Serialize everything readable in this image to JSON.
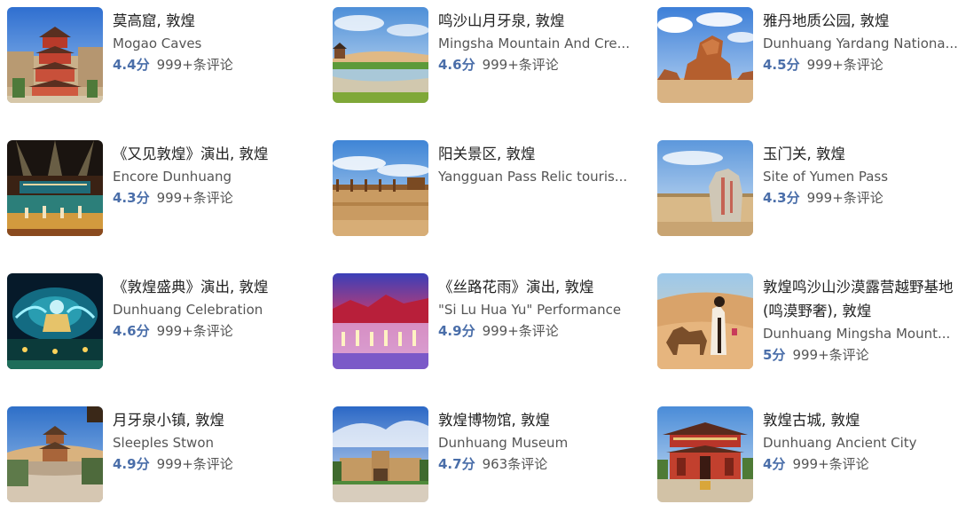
{
  "items": [
    {
      "title": "莫高窟, 敦煌",
      "en": "Mogao Caves",
      "rating": "4.4分",
      "reviews": "999+条评论",
      "image": "mogao-caves-pagoda-photo"
    },
    {
      "title": "鸣沙山月牙泉, 敦煌",
      "en": "Mingsha Mountain And Cre...",
      "rating": "4.6分",
      "reviews": "999+条评论",
      "image": "crescent-lake-photo"
    },
    {
      "title": "雅丹地质公园, 敦煌",
      "en": "Dunhuang Yardang Nationa...",
      "rating": "4.5分",
      "reviews": "999+条评论",
      "image": "yardang-rock-photo"
    },
    {
      "title": "《又见敦煌》演出, 敦煌",
      "en": "Encore Dunhuang",
      "rating": "4.3分",
      "reviews": "999+条评论",
      "image": "encore-stage-photo"
    },
    {
      "title": "阳关景区, 敦煌",
      "en": "Yangguan Pass Relic touris...",
      "rating": "",
      "reviews": "",
      "image": "yangguan-pass-photo"
    },
    {
      "title": "玉门关, 敦煌",
      "en": "Site of Yumen Pass",
      "rating": "4.3分",
      "reviews": "999+条评论",
      "image": "yumen-pass-stone-photo"
    },
    {
      "title": "《敦煌盛典》演出, 敦煌",
      "en": "Dunhuang Celebration",
      "rating": "4.6分",
      "reviews": "999+条评论",
      "image": "celebration-show-photo"
    },
    {
      "title": "《丝路花雨》演出, 敦煌",
      "en": "\"Si Lu Hua Yu\" Performance",
      "rating": "4.9分",
      "reviews": "999+条评论",
      "image": "silk-road-dance-photo"
    },
    {
      "title": "敦煌鸣沙山沙漠露营越野基地(鸣漠野奢), 敦煌",
      "en": "Dunhuang Mingsha Mount...",
      "rating": "5分",
      "reviews": "999+条评论",
      "image": "desert-camel-photo"
    },
    {
      "title": "月牙泉小镇, 敦煌",
      "en": "Sleeples Stwon",
      "rating": "4.9分",
      "reviews": "999+条评论",
      "image": "crescent-town-photo"
    },
    {
      "title": "敦煌博物馆, 敦煌",
      "en": "Dunhuang Museum",
      "rating": "4.7分",
      "reviews": "963条评论",
      "image": "museum-building-photo"
    },
    {
      "title": "敦煌古城, 敦煌",
      "en": "Dunhuang Ancient City",
      "rating": "4分",
      "reviews": "999+条评论",
      "image": "ancient-city-gate-photo"
    }
  ]
}
